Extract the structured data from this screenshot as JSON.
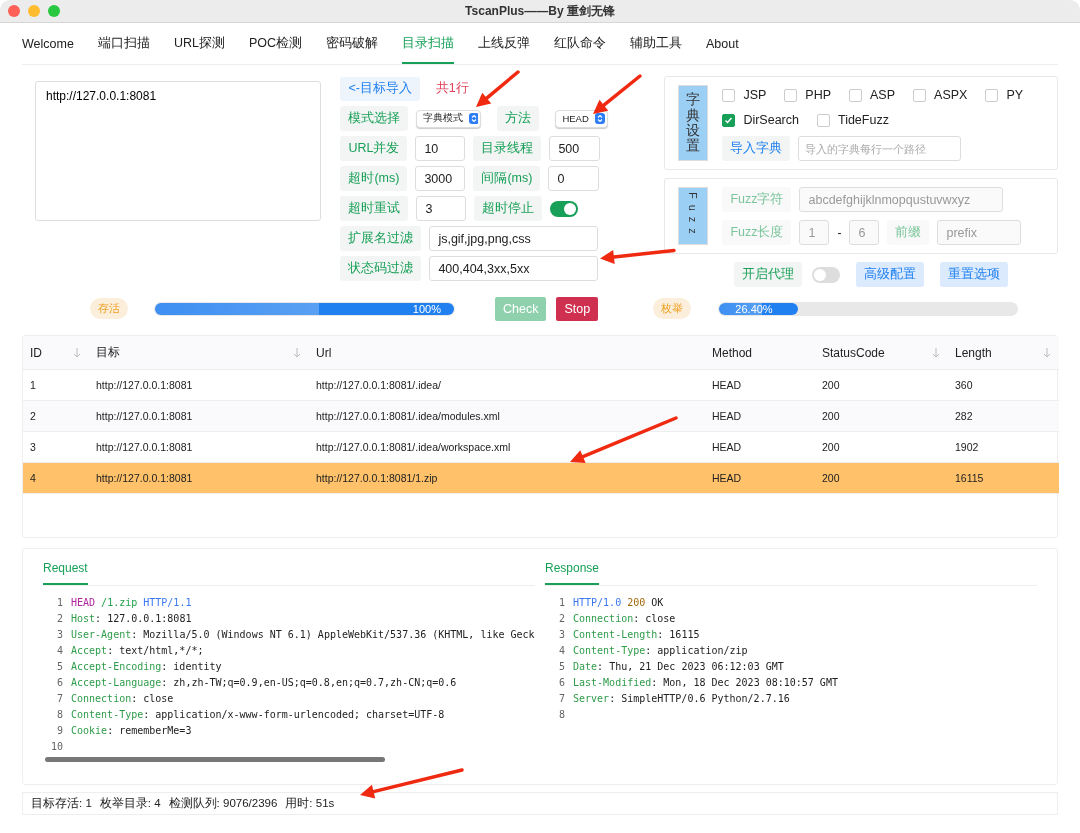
{
  "window": {
    "title": "TscanPlus——By 重剑无锋"
  },
  "tabs": [
    {
      "label": "Welcome",
      "selected": false
    },
    {
      "label": "端口扫描",
      "selected": false
    },
    {
      "label": "URL探测",
      "selected": false
    },
    {
      "label": "POC检测",
      "selected": false
    },
    {
      "label": "密码破解",
      "selected": false
    },
    {
      "label": "目录扫描",
      "selected": true
    },
    {
      "label": "上线反弹",
      "selected": false
    },
    {
      "label": "红队命令",
      "selected": false
    },
    {
      "label": "辅助工具",
      "selected": false
    },
    {
      "label": "About",
      "selected": false
    }
  ],
  "targets": {
    "value": "http://127.0.0.1:8081"
  },
  "import_button": "<-目标导入",
  "line_count": "共1行",
  "mode": {
    "label": "模式选择",
    "value": "字典模式"
  },
  "method": {
    "label": "方法",
    "value": "HEAD"
  },
  "params": [
    {
      "label": "URL并发",
      "value": "10",
      "label2": "目录线程",
      "value2": "500",
      "kind": "inputs"
    },
    {
      "label": "超时(ms)",
      "value": "3000",
      "label2": "间隔(ms)",
      "value2": "0",
      "kind": "inputs"
    },
    {
      "label": "超时重试",
      "value": "3",
      "label2": "超时停止",
      "on": true,
      "kind": "toggle"
    }
  ],
  "filters": [
    {
      "label": "扩展名过滤",
      "value": "js,gif,jpg,png,css"
    },
    {
      "label": "状态码过滤",
      "value": "400,404,3xx,5xx"
    }
  ],
  "dict": {
    "title": "字典设置",
    "options": [
      {
        "label": "JSP",
        "checked": false
      },
      {
        "label": "PHP",
        "checked": false
      },
      {
        "label": "ASP",
        "checked": false
      },
      {
        "label": "ASPX",
        "checked": false
      },
      {
        "label": "PY",
        "checked": false
      },
      {
        "label": "DirSearch",
        "checked": true
      },
      {
        "label": "TideFuzz",
        "checked": false
      }
    ],
    "import_button": "导入字典",
    "path": {
      "placeholder": "导入的字典每行一个路径"
    }
  },
  "fuzz": {
    "title": "Fuzz",
    "disabled": true,
    "chars_label": "Fuzz字符",
    "chars": "abcdefghijklnmopqustuvwxyz",
    "length_label": "Fuzz长度",
    "min": "1",
    "sep": "-",
    "max": "6",
    "prefix_label": "前缀",
    "prefix": {
      "placeholder": "prefix"
    }
  },
  "proxy": {
    "label": "开启代理",
    "on": false
  },
  "advanced_button": "高级配置",
  "reset_button": "重置选项",
  "alive": {
    "tag": "存活",
    "level": 1.0,
    "reading": "100%"
  },
  "check_button": {
    "label": "Check",
    "disabled": true
  },
  "stop_button": {
    "label": "Stop",
    "disabled": false
  },
  "enum": {
    "tag": "枚举",
    "level": 0.264,
    "reading": "26.40%"
  },
  "table": {
    "columns": [
      {
        "label": "ID",
        "sortable": true
      },
      {
        "label": "目标",
        "sortable": true
      },
      {
        "label": "Url",
        "sortable": false
      },
      {
        "label": "Method",
        "sortable": false
      },
      {
        "label": "StatusCode",
        "sortable": true
      },
      {
        "label": "Length",
        "sortable": true
      }
    ],
    "rows": [
      {
        "cells": [
          "1",
          "http://127.0.0.1:8081",
          "http://127.0.0.1:8081/.idea/",
          "HEAD",
          "200",
          "360"
        ],
        "selected": false
      },
      {
        "cells": [
          "2",
          "http://127.0.0.1:8081",
          "http://127.0.0.1:8081/.idea/modules.xml",
          "HEAD",
          "200",
          "282"
        ],
        "selected": false
      },
      {
        "cells": [
          "3",
          "http://127.0.0.1:8081",
          "http://127.0.0.1:8081/.idea/workspace.xml",
          "HEAD",
          "200",
          "1902"
        ],
        "selected": false
      },
      {
        "cells": [
          "4",
          "http://127.0.0.1:8081",
          "http://127.0.0.1:8081/1.zip",
          "HEAD",
          "200",
          "16115"
        ],
        "selected": true
      }
    ]
  },
  "request": {
    "title": "Request",
    "lines": [
      {
        "no": "1",
        "parts": [
          {
            "kind": "method",
            "text": "HEAD"
          },
          {
            "kind": "path",
            "text": " /1.zip"
          },
          {
            "kind": "proto",
            "text": " HTTP/1.1"
          }
        ]
      },
      {
        "no": "2",
        "parts": [
          {
            "kind": "key",
            "text": "Host"
          },
          {
            "kind": "plain",
            "text": ": 127.0.0.1:8081"
          }
        ]
      },
      {
        "no": "3",
        "parts": [
          {
            "kind": "key",
            "text": "User-Agent"
          },
          {
            "kind": "plain",
            "text": ": Mozilla/5.0 (Windows NT 6.1) AppleWebKit/537.36 (KHTML, like Geck"
          }
        ]
      },
      {
        "no": "4",
        "parts": [
          {
            "kind": "key",
            "text": "Accept"
          },
          {
            "kind": "plain",
            "text": ": text/html,*/*;"
          }
        ]
      },
      {
        "no": "5",
        "parts": [
          {
            "kind": "key",
            "text": "Accept-Encoding"
          },
          {
            "kind": "plain",
            "text": ": identity"
          }
        ]
      },
      {
        "no": "6",
        "parts": [
          {
            "kind": "key",
            "text": "Accept-Language"
          },
          {
            "kind": "plain",
            "text": ": zh,zh-TW;q=0.9,en-US;q=0.8,en;q=0.7,zh-CN;q=0.6"
          }
        ]
      },
      {
        "no": "7",
        "parts": [
          {
            "kind": "key",
            "text": "Connection"
          },
          {
            "kind": "plain",
            "text": ": close"
          }
        ]
      },
      {
        "no": "8",
        "parts": [
          {
            "kind": "key",
            "text": "Content-Type"
          },
          {
            "kind": "plain",
            "text": ": application/x-www-form-urlencoded; charset=UTF-8"
          }
        ]
      },
      {
        "no": "9",
        "parts": [
          {
            "kind": "key",
            "text": "Cookie"
          },
          {
            "kind": "plain",
            "text": ": rememberMe=3"
          }
        ]
      },
      {
        "no": "10"
      }
    ]
  },
  "response": {
    "title": "Response",
    "lines": [
      {
        "no": "1",
        "parts": [
          {
            "kind": "proto",
            "text": "HTTP/1.0"
          },
          {
            "kind": "status",
            "text": " 200"
          },
          {
            "kind": "plain",
            "text": " OK"
          }
        ]
      },
      {
        "no": "2",
        "parts": [
          {
            "kind": "key",
            "text": "Connection"
          },
          {
            "kind": "plain",
            "text": ": close"
          }
        ]
      },
      {
        "no": "3",
        "parts": [
          {
            "kind": "key",
            "text": "Content-Length"
          },
          {
            "kind": "plain",
            "text": ": 16115"
          }
        ]
      },
      {
        "no": "4",
        "parts": [
          {
            "kind": "key",
            "text": "Content-Type"
          },
          {
            "kind": "plain",
            "text": ": application/zip"
          }
        ]
      },
      {
        "no": "5",
        "parts": [
          {
            "kind": "key",
            "text": "Date"
          },
          {
            "kind": "plain",
            "text": ": Thu, 21 Dec 2023 06:12:03 GMT"
          }
        ]
      },
      {
        "no": "6",
        "parts": [
          {
            "kind": "key",
            "text": "Last-Modified"
          },
          {
            "kind": "plain",
            "text": ": Mon, 18 Dec 2023 08:10:57 GMT"
          }
        ]
      },
      {
        "no": "7",
        "parts": [
          {
            "kind": "key",
            "text": "Server"
          },
          {
            "kind": "plain",
            "text": ": SimpleHTTP/0.6 Python/2.7.16"
          }
        ]
      },
      {
        "no": "8"
      }
    ]
  },
  "status_bar": [
    "目标存活: 1",
    "枚举目录: 4",
    "检测队列: 9076/2396",
    "用时: 51s"
  ]
}
